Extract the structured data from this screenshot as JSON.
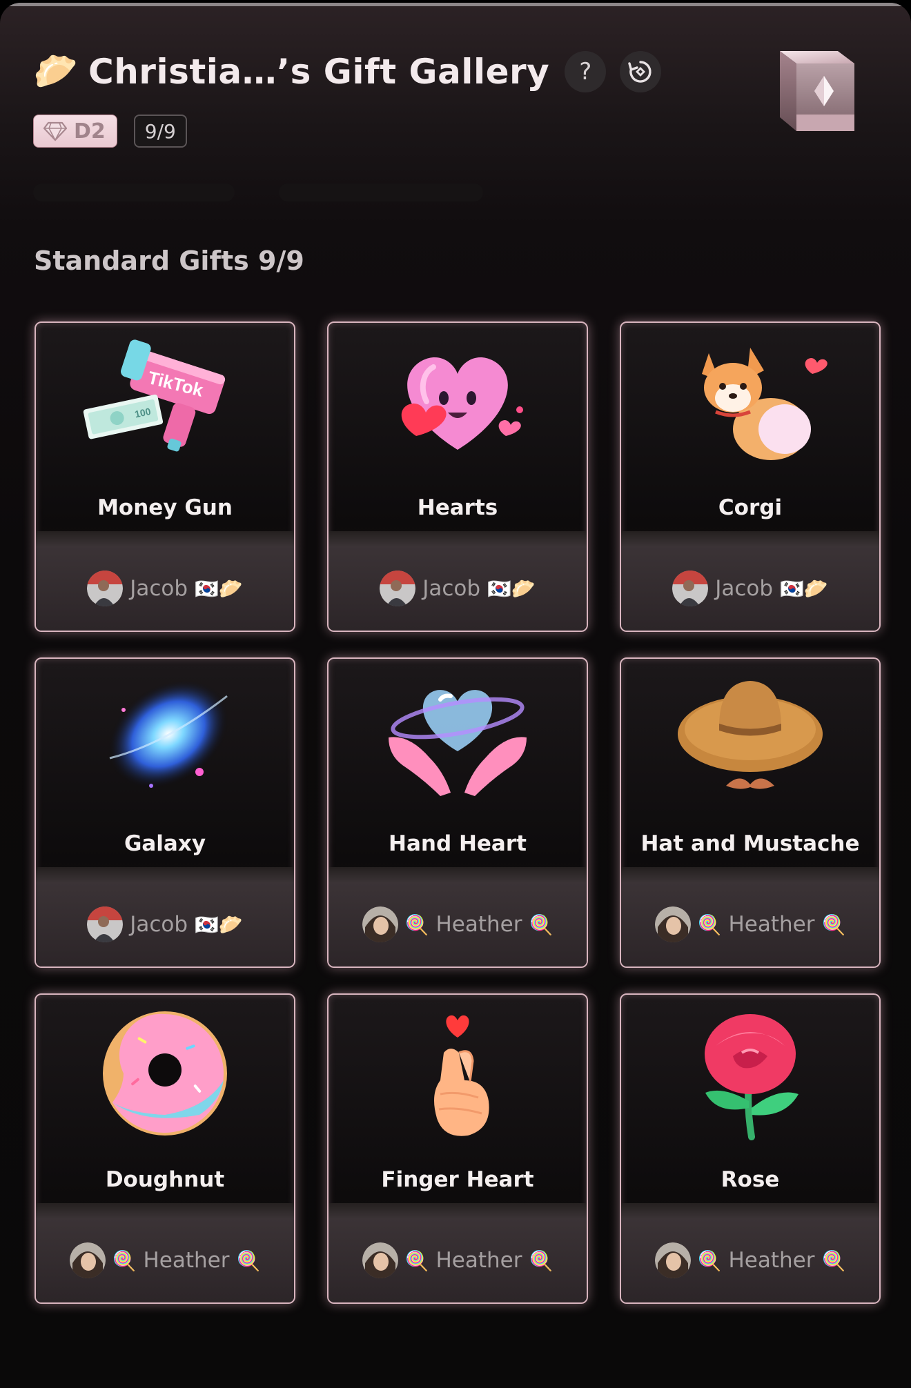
{
  "header": {
    "title_emoji": "🥟",
    "title": "Christia…’s Gift Gallery",
    "help_icon": "?",
    "level_badge": "D2",
    "collected_count": "9/9"
  },
  "section": {
    "title": "Standard Gifts 9/9"
  },
  "gifts": [
    {
      "name": "Money Gun",
      "icon": "money-gun-icon",
      "sender": "Jacob",
      "sender_prefix": "",
      "sender_suffix": "🇰🇷🥟",
      "avatar": "jacob"
    },
    {
      "name": "Hearts",
      "icon": "hearts-icon",
      "sender": "Jacob",
      "sender_prefix": "",
      "sender_suffix": "🇰🇷🥟",
      "avatar": "jacob"
    },
    {
      "name": "Corgi",
      "icon": "corgi-icon",
      "sender": "Jacob",
      "sender_prefix": "",
      "sender_suffix": "🇰🇷🥟",
      "avatar": "jacob"
    },
    {
      "name": "Galaxy",
      "icon": "galaxy-icon",
      "sender": "Jacob",
      "sender_prefix": "",
      "sender_suffix": "🇰🇷🥟",
      "avatar": "jacob"
    },
    {
      "name": "Hand Heart",
      "icon": "hand-heart-icon",
      "sender": "Heather",
      "sender_prefix": "🍭",
      "sender_suffix": "🍭",
      "avatar": "heather"
    },
    {
      "name": "Hat and Mustache",
      "icon": "hat-and-mustache-icon",
      "sender": "Heather",
      "sender_prefix": "🍭",
      "sender_suffix": "🍭",
      "avatar": "heather"
    },
    {
      "name": "Doughnut",
      "icon": "doughnut-icon",
      "sender": "Heather",
      "sender_prefix": "🍭",
      "sender_suffix": "🍭",
      "avatar": "heather"
    },
    {
      "name": "Finger Heart",
      "icon": "finger-heart-icon",
      "sender": "Heather",
      "sender_prefix": "🍭",
      "sender_suffix": "🍭",
      "avatar": "heather"
    },
    {
      "name": "Rose",
      "icon": "rose-icon",
      "sender": "Heather",
      "sender_prefix": "🍭",
      "sender_suffix": "🍭",
      "avatar": "heather"
    }
  ],
  "colors": {
    "card_border": "#d9b5bf",
    "badge_pink": "#f5dfe5",
    "text_primary": "#f4efef"
  }
}
